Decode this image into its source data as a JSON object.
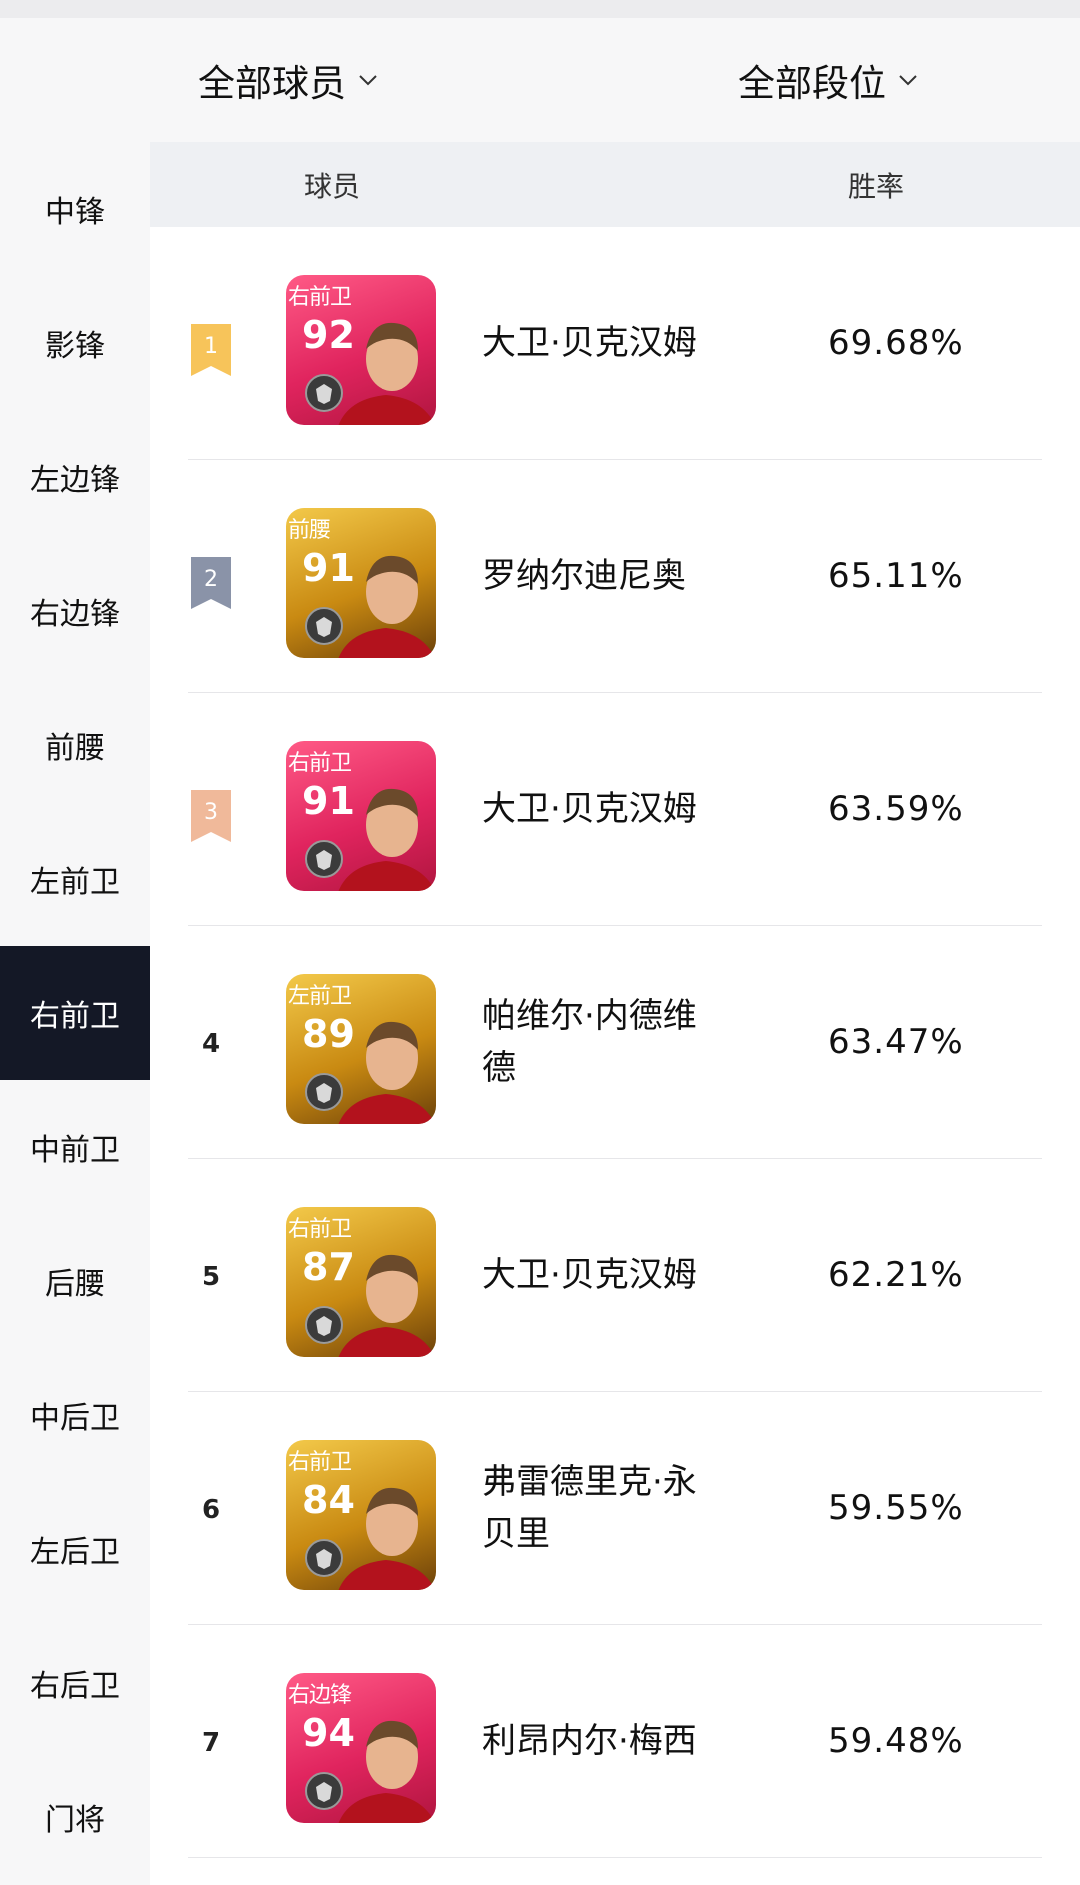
{
  "filters": {
    "players_label": "全部球员",
    "tiers_label": "全部段位"
  },
  "sidebar": {
    "items": [
      {
        "label": "中锋"
      },
      {
        "label": "影锋"
      },
      {
        "label": "左边锋"
      },
      {
        "label": "右边锋"
      },
      {
        "label": "前腰"
      },
      {
        "label": "左前卫"
      },
      {
        "label": "右前卫",
        "active": true
      },
      {
        "label": "中前卫"
      },
      {
        "label": "后腰"
      },
      {
        "label": "中后卫"
      },
      {
        "label": "左后卫"
      },
      {
        "label": "右后卫"
      },
      {
        "label": "门将"
      }
    ]
  },
  "table": {
    "header_player": "球员",
    "header_winrate": "胜率",
    "rows": [
      {
        "rank": "1",
        "badge_color": "#f7c45a",
        "card_style": "pink",
        "card_position": "右前卫",
        "rating": "92",
        "name": "大卫·贝克汉姆",
        "winrate": "69.68%"
      },
      {
        "rank": "2",
        "badge_color": "#8a93a8",
        "card_style": "gold",
        "card_position": "前腰",
        "rating": "91",
        "name": "罗纳尔迪尼奥",
        "winrate": "65.11%"
      },
      {
        "rank": "3",
        "badge_color": "#f0b99a",
        "card_style": "pink",
        "card_position": "右前卫",
        "rating": "91",
        "name": "大卫·贝克汉姆",
        "winrate": "63.59%"
      },
      {
        "rank": "4",
        "card_style": "gold",
        "card_position": "左前卫",
        "rating": "89",
        "name": "帕维尔·内德维德",
        "winrate": "63.47%"
      },
      {
        "rank": "5",
        "card_style": "gold",
        "card_position": "右前卫",
        "rating": "87",
        "name": "大卫·贝克汉姆",
        "winrate": "62.21%"
      },
      {
        "rank": "6",
        "card_style": "gold",
        "card_position": "右前卫",
        "rating": "84",
        "name": "弗雷德里克·永贝里",
        "winrate": "59.55%"
      },
      {
        "rank": "7",
        "card_style": "pink",
        "card_position": "右边锋",
        "rating": "94",
        "name": "利昂内尔·梅西",
        "winrate": "59.48%"
      }
    ]
  }
}
